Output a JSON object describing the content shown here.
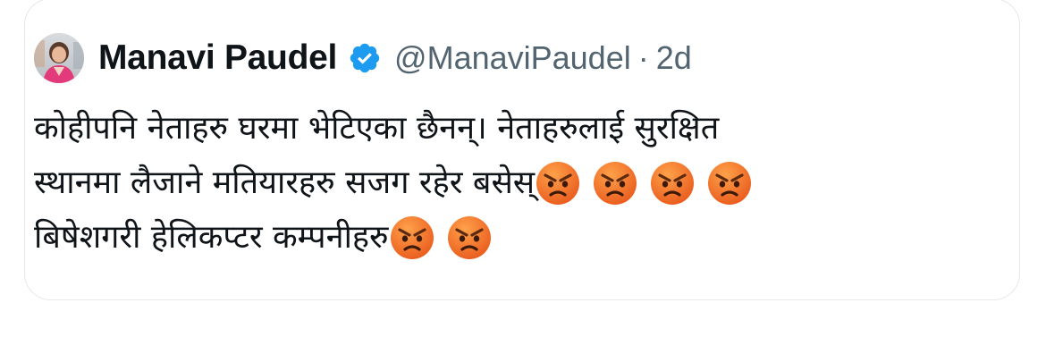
{
  "tweet": {
    "author_name": "Manavi Paudel",
    "handle": "@ManaviPaudel",
    "separator": "·",
    "time": "2d",
    "verified_icon": "verified-badge-icon",
    "avatar_icon": "profile-avatar",
    "lines": [
      {
        "text": "कोहीपनि नेताहरु घरमा भेटिएका छैनन्। नेताहरुलाई सुरक्षित",
        "emoji_count": 0
      },
      {
        "text": "स्थानमा लैजाने मतियारहरु सजग रहेर बसेस्",
        "emoji_count": 4
      },
      {
        "text": "बिषेशगरी हेलिकप्टर कम्पनीहरु",
        "emoji_count": 2
      }
    ],
    "emoji_name": "angry-face-emoji"
  },
  "colors": {
    "text": "#0f1419",
    "secondary": "#536471",
    "verified": "#1d9bf0",
    "border": "#e6e8ea",
    "emoji_face": "#f4761c"
  }
}
